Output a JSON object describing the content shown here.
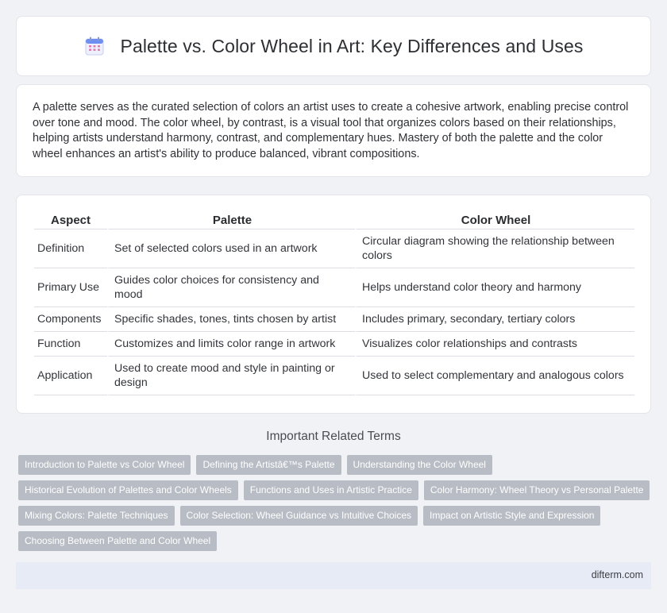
{
  "header": {
    "title": "Palette vs. Color Wheel in Art: Key Differences and Uses",
    "icon": "calendar-icon"
  },
  "intro": {
    "text": "A palette serves as the curated selection of colors an artist uses to create a cohesive artwork, enabling precise control over tone and mood. The color wheel, by contrast, is a visual tool that organizes colors based on their relationships, helping artists understand harmony, contrast, and complementary hues. Mastery of both the palette and the color wheel enhances an artist's ability to produce balanced, vibrant compositions."
  },
  "table": {
    "headers": [
      "Aspect",
      "Palette",
      "Color Wheel"
    ],
    "rows": [
      [
        "Definition",
        "Set of selected colors used in an artwork",
        "Circular diagram showing the relationship between colors"
      ],
      [
        "Primary Use",
        "Guides color choices for consistency and mood",
        "Helps understand color theory and harmony"
      ],
      [
        "Components",
        "Specific shades, tones, tints chosen by artist",
        "Includes primary, secondary, tertiary colors"
      ],
      [
        "Function",
        "Customizes and limits color range in artwork",
        "Visualizes color relationships and contrasts"
      ],
      [
        "Application",
        "Used to create mood and style in painting or design",
        "Used to select complementary and analogous colors"
      ]
    ]
  },
  "related": {
    "title": "Important Related Terms",
    "tags": [
      "Introduction to Palette vs Color Wheel",
      "Defining the Artistâ€™s Palette",
      "Understanding the Color Wheel",
      "Historical Evolution of Palettes and Color Wheels",
      "Functions and Uses in Artistic Practice",
      "Color Harmony: Wheel Theory vs Personal Palette",
      "Mixing Colors: Palette Techniques",
      "Color Selection: Wheel Guidance vs Intuitive Choices",
      "Impact on Artistic Style and Expression",
      "Choosing Between Palette and Color Wheel"
    ]
  },
  "footer": {
    "site": "difterm.com"
  },
  "colors": {
    "background": "#f1f2f5",
    "tag": "#b8bcc4",
    "footer": "#e6ebf5",
    "icon_accent": "#5b8def"
  }
}
